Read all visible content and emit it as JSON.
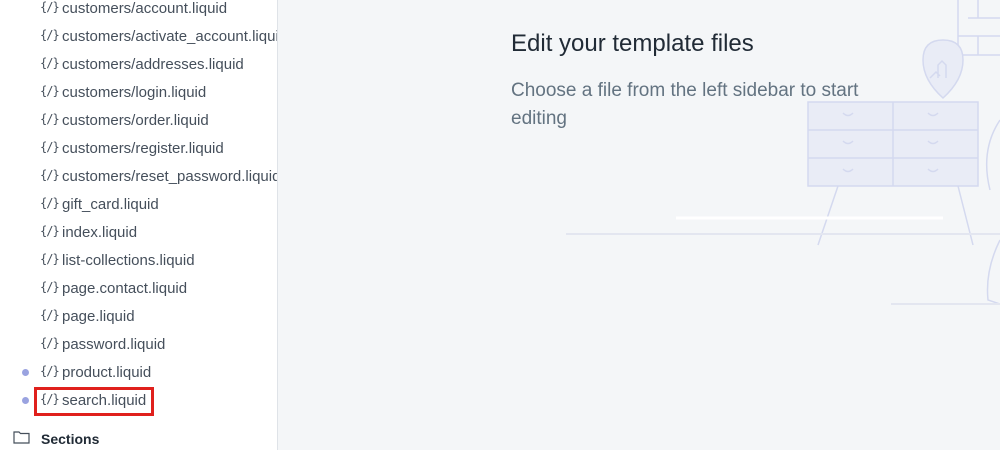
{
  "sidebar": {
    "files": [
      {
        "icon": "{/}",
        "label": "customers/account.liquid",
        "modified": false
      },
      {
        "icon": "{/}",
        "label": "customers/activate_account.liquid",
        "modified": false
      },
      {
        "icon": "{/}",
        "label": "customers/addresses.liquid",
        "modified": false
      },
      {
        "icon": "{/}",
        "label": "customers/login.liquid",
        "modified": false
      },
      {
        "icon": "{/}",
        "label": "customers/order.liquid",
        "modified": false
      },
      {
        "icon": "{/}",
        "label": "customers/register.liquid",
        "modified": false
      },
      {
        "icon": "{/}",
        "label": "customers/reset_password.liquid",
        "modified": false
      },
      {
        "icon": "{/}",
        "label": "gift_card.liquid",
        "modified": false
      },
      {
        "icon": "{/}",
        "label": "index.liquid",
        "modified": false
      },
      {
        "icon": "{/}",
        "label": "list-collections.liquid",
        "modified": false
      },
      {
        "icon": "{/}",
        "label": "page.contact.liquid",
        "modified": false
      },
      {
        "icon": "{/}",
        "label": "page.liquid",
        "modified": false
      },
      {
        "icon": "{/}",
        "label": "password.liquid",
        "modified": false
      },
      {
        "icon": "{/}",
        "label": "product.liquid",
        "modified": true
      },
      {
        "icon": "{/}",
        "label": "search.liquid",
        "modified": true
      }
    ],
    "section_folder": {
      "label": "Sections",
      "icon": "folder-icon"
    }
  },
  "main": {
    "title": "Edit your template files",
    "description": "Choose a file from the left sidebar to start editing"
  },
  "colors": {
    "highlight": "#e0201c",
    "modified_dot": "#9aa3e0",
    "sidebar_bg": "#ffffff",
    "main_bg": "#f4f6f8"
  }
}
